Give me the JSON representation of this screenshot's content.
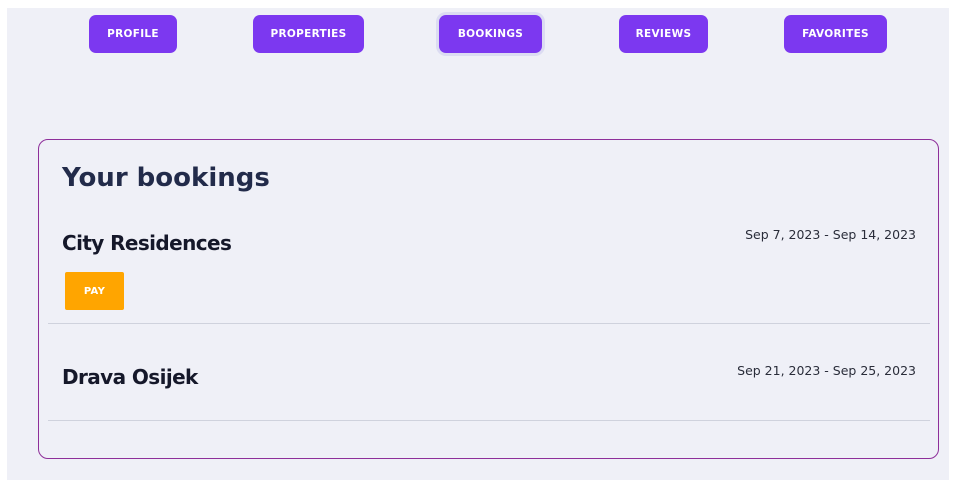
{
  "nav": {
    "tabs": [
      {
        "label": "PROFILE"
      },
      {
        "label": "PROPERTIES"
      },
      {
        "label": "BOOKINGS",
        "active": true
      },
      {
        "label": "REVIEWS"
      },
      {
        "label": "FAVORITES"
      }
    ]
  },
  "bookings": {
    "title": "Your bookings",
    "items": [
      {
        "name": "City Residences",
        "dates": "Sep 7, 2023 - Sep 14, 2023",
        "action_label": "PAY"
      },
      {
        "name": "Drava Osijek",
        "dates": "Sep 21, 2023 - Sep 25, 2023"
      }
    ]
  },
  "colors": {
    "tab_background": "#7c38f0",
    "pay_button": "#ffa500",
    "card_border": "#8e2f9a",
    "page_background": "#eff0f7",
    "title_text": "#222b4a"
  }
}
